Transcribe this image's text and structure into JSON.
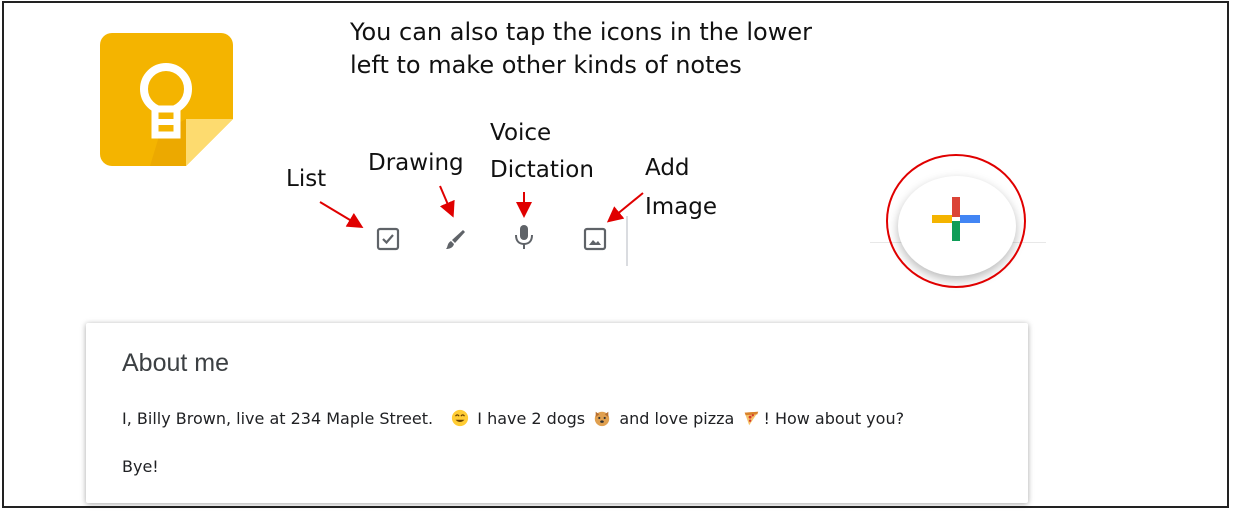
{
  "caption": {
    "line1": "You can also tap the icons in the lower",
    "line2": "left to make other kinds of notes"
  },
  "labels": {
    "list": "List",
    "drawing": "Drawing",
    "voice_line1": "Voice",
    "voice_line2": "Dictation",
    "image_line1": "Add",
    "image_line2": "Image"
  },
  "toolbar": {
    "icons": [
      "checkbox-icon",
      "brush-icon",
      "microphone-icon",
      "image-icon"
    ]
  },
  "colors": {
    "keep_yellow": "#f4b400",
    "annotation_red": "#e00000",
    "plus_red": "#db4437",
    "plus_blue": "#4285f4",
    "plus_green": "#0f9d58",
    "plus_yellow": "#f4b400"
  },
  "note": {
    "title": "About me",
    "body_part1": "I, Billy Brown, live at 234 Maple Street.",
    "body_part2": "I have 2 dogs",
    "body_part3": "and love pizza",
    "body_part4": "! How about you?",
    "bye": "Bye!"
  }
}
